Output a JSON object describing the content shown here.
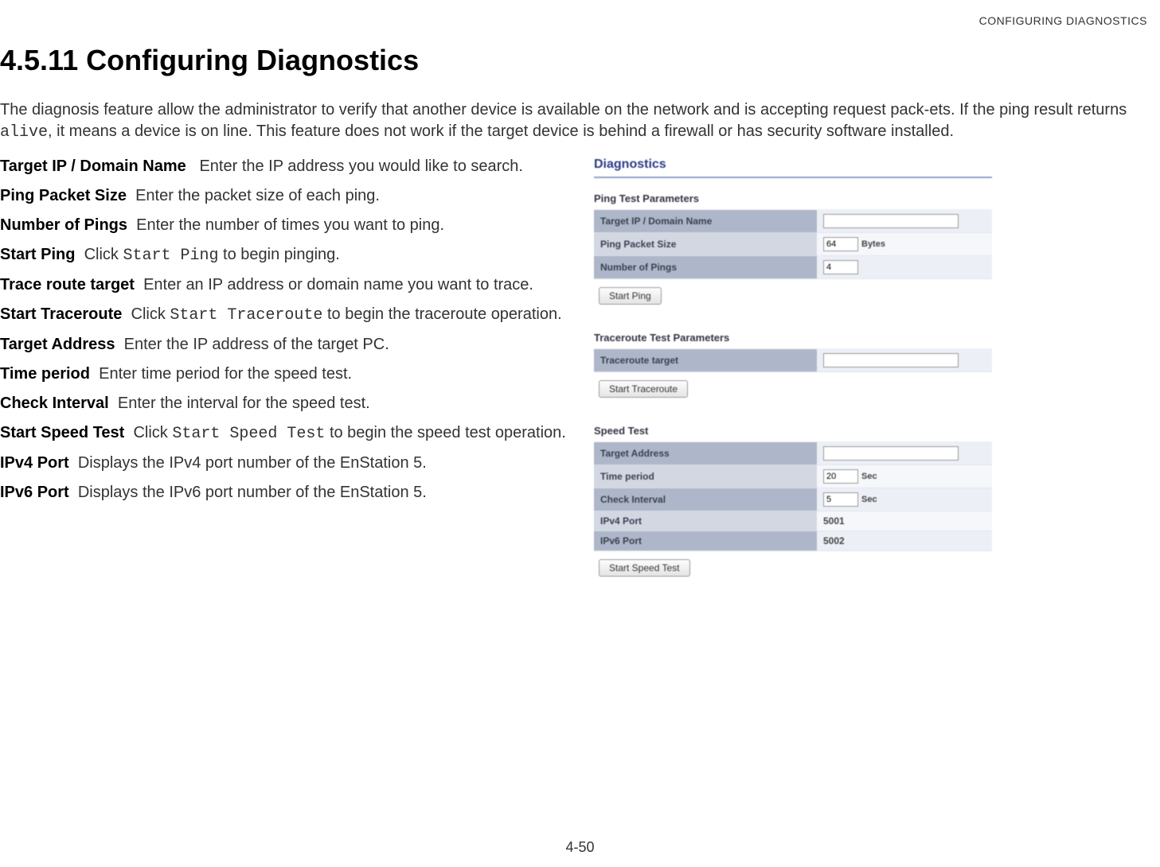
{
  "header": {
    "right": "CONFIGURING DIAGNOSTICS"
  },
  "title": "4.5.11 Configuring Diagnostics",
  "intro": {
    "pre": "The diagnosis feature allow the administrator to verify that another device is available on the network and is accepting request pack-ets. If the ping result returns ",
    "code": "alive",
    "post": ", it means a device is on line. This feature does not work if the target device is behind a firewall or has security software installed."
  },
  "defs": {
    "target_ip": {
      "term": "Target IP / Domain Name",
      "desc": "Enter the IP address you would like to search."
    },
    "ping_size": {
      "term": "Ping Packet Size",
      "desc": "Enter the packet size of each ping."
    },
    "num_pings": {
      "term": "Number of Pings",
      "desc": "Enter the number of times you want to ping."
    },
    "start_ping": {
      "term": "Start Ping",
      "pre": "Click ",
      "code": "Start Ping",
      "post": " to begin pinging."
    },
    "trace_target": {
      "term": "Trace route target",
      "desc": "Enter an IP address or domain name you want to trace."
    },
    "start_trace": {
      "term": "Start Traceroute",
      "pre": "Click ",
      "code": "Start Traceroute",
      "post": " to begin the traceroute operation."
    },
    "target_addr": {
      "term": "Target Address",
      "desc": "Enter the IP address of the target PC."
    },
    "time_period": {
      "term": "Time period",
      "desc": "Enter time period for the speed test."
    },
    "check_interval": {
      "term": "Check Interval",
      "desc": "Enter the interval for the speed test."
    },
    "start_speed": {
      "term": "Start Speed Test",
      "pre": "Click ",
      "code": "Start Speed Test",
      "post": " to begin the speed test operation."
    },
    "ipv4": {
      "term": "IPv4 Port",
      "desc": "Displays the IPv4 port number of the EnStation 5."
    },
    "ipv6": {
      "term": "IPv6 Port",
      "desc": "Displays the IPv6 port number of the EnStation 5."
    }
  },
  "panel": {
    "title": "Diagnostics",
    "ping": {
      "head": "Ping Test Parameters",
      "target_ip_label": "Target IP / Domain Name",
      "target_ip_value": "",
      "packet_size_label": "Ping Packet Size",
      "packet_size_value": "64",
      "packet_size_unit": "Bytes",
      "num_pings_label": "Number of Pings",
      "num_pings_value": "4",
      "button": "Start Ping"
    },
    "trace": {
      "head": "Traceroute Test Parameters",
      "target_label": "Traceroute target",
      "target_value": "",
      "button": "Start Traceroute"
    },
    "speed": {
      "head": "Speed Test",
      "target_addr_label": "Target Address",
      "target_addr_value": "",
      "time_period_label": "Time period",
      "time_period_value": "20",
      "time_period_unit": "Sec",
      "check_interval_label": "Check Interval",
      "check_interval_value": "5",
      "check_interval_unit": "Sec",
      "ipv4_label": "IPv4 Port",
      "ipv4_value": "5001",
      "ipv6_label": "IPv6 Port",
      "ipv6_value": "5002",
      "button": "Start Speed Test"
    }
  },
  "pagenum": "4-50"
}
